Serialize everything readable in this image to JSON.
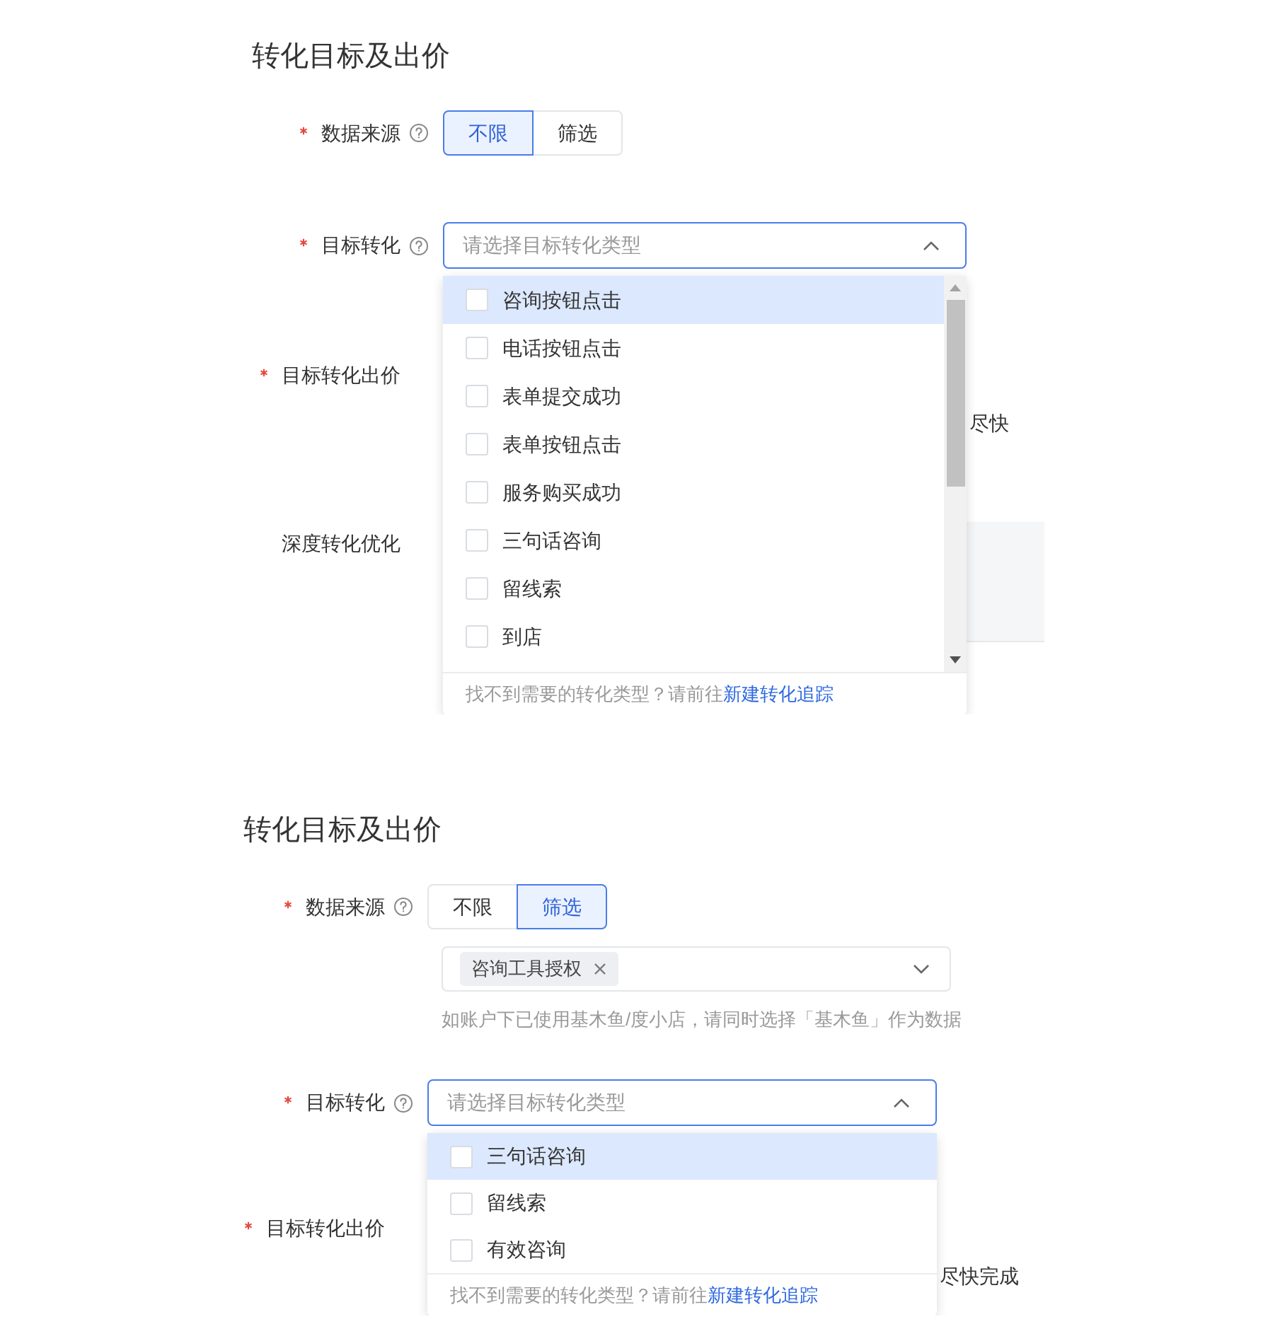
{
  "panels": [
    {
      "title": "转化目标及出价",
      "data_source": {
        "label": "数据来源",
        "required": true,
        "help": true,
        "options": [
          {
            "label": "不限",
            "selected": true
          },
          {
            "label": "筛选",
            "selected": false
          }
        ]
      },
      "target_conversion": {
        "label": "目标转化",
        "required": true,
        "help": true,
        "placeholder": "请选择目标转化类型",
        "expanded": true,
        "scrollbar": true,
        "options": [
          {
            "label": "咨询按钮点击",
            "checked": false,
            "highlighted": true
          },
          {
            "label": "电话按钮点击",
            "checked": false,
            "highlighted": false
          },
          {
            "label": "表单提交成功",
            "checked": false,
            "highlighted": false
          },
          {
            "label": "表单按钮点击",
            "checked": false,
            "highlighted": false
          },
          {
            "label": "服务购买成功",
            "checked": false,
            "highlighted": false
          },
          {
            "label": "三句话咨询",
            "checked": false,
            "highlighted": false
          },
          {
            "label": "留线索",
            "checked": false,
            "highlighted": false
          },
          {
            "label": "到店",
            "checked": false,
            "highlighted": false
          }
        ],
        "footer": {
          "text": "找不到需要的转化类型？请前往",
          "link": "新建转化追踪"
        }
      },
      "bid": {
        "label": "目标转化出价",
        "required": true,
        "note": "尽快"
      },
      "deep_optimization": {
        "label": "深度转化优化"
      }
    },
    {
      "title": "转化目标及出价",
      "data_source": {
        "label": "数据来源",
        "required": true,
        "help": true,
        "options": [
          {
            "label": "不限",
            "selected": false
          },
          {
            "label": "筛选",
            "selected": true
          }
        ],
        "tags": [
          {
            "label": "咨询工具授权"
          }
        ],
        "hint": "如账户下已使用基木鱼/度小店，请同时选择「基木鱼」作为数据"
      },
      "target_conversion": {
        "label": "目标转化",
        "required": true,
        "help": true,
        "placeholder": "请选择目标转化类型",
        "expanded": true,
        "scrollbar": false,
        "options": [
          {
            "label": "三句话咨询",
            "checked": false,
            "highlighted": true
          },
          {
            "label": "留线索",
            "checked": false,
            "highlighted": false
          },
          {
            "label": "有效咨询",
            "checked": false,
            "highlighted": false
          }
        ],
        "footer": {
          "text": "找不到需要的转化类型？请前往",
          "link": "新建转化追踪"
        }
      },
      "bid": {
        "label": "目标转化出价",
        "required": true,
        "note": "尽快完成"
      }
    }
  ]
}
